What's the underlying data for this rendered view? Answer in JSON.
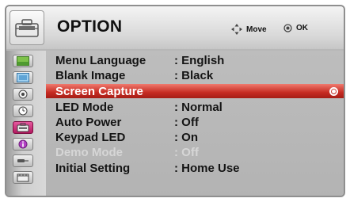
{
  "header": {
    "icon": "toolbox-icon",
    "title": "OPTION",
    "move_label": "Move",
    "ok_label": "OK"
  },
  "sidebar": {
    "items": [
      {
        "icon": "picture-icon",
        "active": false
      },
      {
        "icon": "screen-icon",
        "active": false
      },
      {
        "icon": "audio-icon",
        "active": false
      },
      {
        "icon": "time-icon",
        "active": false
      },
      {
        "icon": "option-icon",
        "active": true
      },
      {
        "icon": "info-icon",
        "active": false
      },
      {
        "icon": "input-icon",
        "active": false
      },
      {
        "icon": "media-icon",
        "active": false
      }
    ]
  },
  "menu": {
    "items": [
      {
        "label": "Menu Language",
        "value": ": English",
        "state": "normal"
      },
      {
        "label": "Blank Image",
        "value": ": Black",
        "state": "normal"
      },
      {
        "label": "Screen Capture",
        "value": "",
        "state": "selected"
      },
      {
        "label": "LED Mode",
        "value": ": Normal",
        "state": "normal"
      },
      {
        "label": "Auto Power",
        "value": ": Off",
        "state": "normal"
      },
      {
        "label": "Keypad LED",
        "value": ": On",
        "state": "normal"
      },
      {
        "label": "Demo Mode",
        "value": ": Off",
        "state": "disabled"
      },
      {
        "label": "Initial Setting",
        "value": ": Home Use",
        "state": "normal"
      }
    ]
  },
  "colors": {
    "selected": "#c62b22",
    "active_tab": "#c12a70",
    "disabled_text": "#d6d6d6"
  }
}
